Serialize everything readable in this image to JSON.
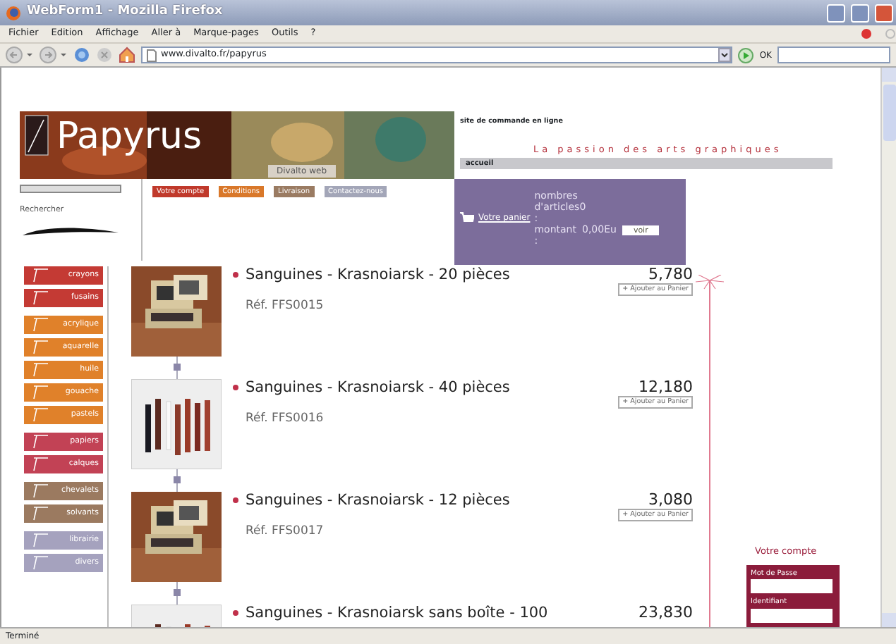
{
  "window": {
    "title": "WebForm1 - Mozilla Firefox"
  },
  "menu": [
    "Fichier",
    "Edition",
    "Affichage",
    "Aller à",
    "Marque-pages",
    "Outils",
    "?"
  ],
  "toolbar": {
    "address": "www.divalto.fr/papyrus",
    "go_label": "OK"
  },
  "header": {
    "brand": "Papyrus",
    "sub_brand": "Divalto web",
    "tagline": "site de commande en ligne",
    "slogan": "La passion des arts graphiques",
    "breadcrumb": "accueil"
  },
  "search": {
    "label": "Rechercher"
  },
  "nav_links": [
    {
      "label": "Votre compte",
      "color": "#c0392b"
    },
    {
      "label": "Conditions",
      "color": "#d9782a"
    },
    {
      "label": "Livraison",
      "color": "#9a7b62"
    },
    {
      "label": "Contactez-nous",
      "color": "#a3a6b8"
    }
  ],
  "cart": {
    "link": "Votre panier",
    "items_label": "nombres d'articles0",
    "items_sep": ":",
    "amount_label": "montant",
    "amount_sep": ":",
    "amount": "0,00Eu",
    "button": "voir"
  },
  "categories": [
    [
      {
        "label": "crayons",
        "color": "#c43a34"
      },
      {
        "label": "fusains",
        "color": "#c43a34"
      }
    ],
    [
      {
        "label": "acrylique",
        "color": "#e0812a"
      },
      {
        "label": "aquarelle",
        "color": "#e0812a"
      },
      {
        "label": "huile",
        "color": "#e0812a"
      },
      {
        "label": "gouache",
        "color": "#e0812a"
      },
      {
        "label": "pastels",
        "color": "#e0812a"
      }
    ],
    [
      {
        "label": "papiers",
        "color": "#c24255"
      },
      {
        "label": "calques",
        "color": "#c24255"
      }
    ],
    [
      {
        "label": "chevalets",
        "color": "#9b7a60"
      },
      {
        "label": "solvants",
        "color": "#9b7a60"
      }
    ],
    [
      {
        "label": "librairie",
        "color": "#a5a2be"
      },
      {
        "label": "divers",
        "color": "#a5a2be"
      }
    ]
  ],
  "products": [
    {
      "title": "Sanguines - Krasnoiarsk - 20 pièces",
      "ref": "Réf. FFS0015",
      "price": "5,780",
      "button": "+ Ajouter au Panier"
    },
    {
      "title": "Sanguines - Krasnoiarsk - 40 pièces",
      "ref": "Réf. FFS0016",
      "price": "12,180",
      "button": "+ Ajouter au Panier"
    },
    {
      "title": "Sanguines - Krasnoiarsk - 12 pièces",
      "ref": "Réf. FFS0017",
      "price": "3,080",
      "button": "+ Ajouter au Panier"
    },
    {
      "title": "Sanguines - Krasnoiarsk sans boîte - 100",
      "price": "23,830"
    }
  ],
  "account": {
    "title": "Votre compte",
    "fields": [
      "Mot de Passe",
      "Identifiant"
    ]
  },
  "status_bar": "Terminé"
}
